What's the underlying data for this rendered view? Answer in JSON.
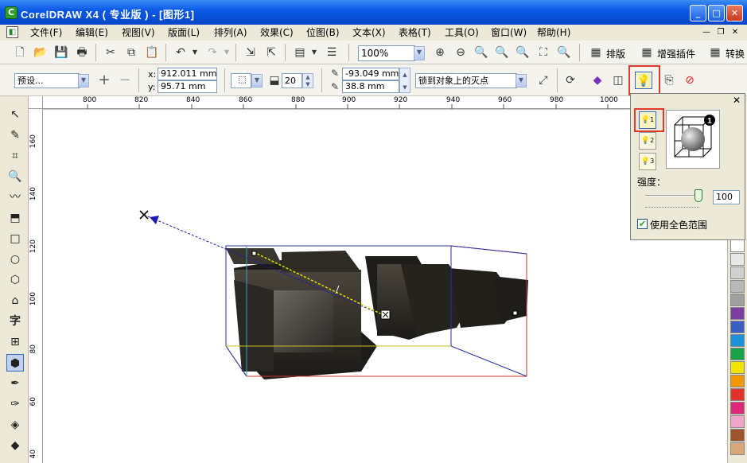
{
  "window": {
    "title": "CorelDRAW X4 ( 专业版 ) - [图形1]",
    "app_icon": "coreldraw-icon"
  },
  "menu": [
    "文件(F)",
    "编辑(E)",
    "视图(V)",
    "版面(L)",
    "排列(A)",
    "效果(C)",
    "位图(B)",
    "文本(X)",
    "表格(T)",
    "工具(O)",
    "窗口(W)",
    "帮助(H)"
  ],
  "toolbar1": {
    "zoom": "100%",
    "layout_label": "排版",
    "plugin_label": "增强插件",
    "convert_label": "转换"
  },
  "propbar": {
    "preset": "预设...",
    "x_label": "x:",
    "x_value": "912.011 mm",
    "y_label": "y:",
    "y_value": "95.71 mm",
    "depth_value": "20",
    "vp_x": "-93.049 mm",
    "vp_y": "38.8 mm",
    "vp_lock": "锁到对象上的灭点"
  },
  "ruler": {
    "h_ticks": [
      "800",
      "820",
      "840",
      "860",
      "880",
      "900",
      "920",
      "940",
      "960",
      "980",
      "1000"
    ],
    "v_ticks": [
      "160",
      "140",
      "120",
      "100",
      "80",
      "60",
      "40"
    ]
  },
  "lighting_panel": {
    "lights": [
      "1",
      "2",
      "3"
    ],
    "preview_badge": "1",
    "intensity_label": "强度：",
    "intensity_value": "100",
    "intensity": 100,
    "full_color_label": "使用全色范围",
    "full_color_checked": true
  },
  "colors": {
    "accent": "#e1392c",
    "titlebar": "#0a5ae6"
  },
  "palette": [
    "#ffffff",
    "#e8e8e8",
    "#d0d0d0",
    "#b8b8b8",
    "#a0a0a0",
    "#7b3fa0",
    "#3c5ec0",
    "#1e90d8",
    "#19a34a",
    "#f2e600",
    "#f39800",
    "#e4312b",
    "#e0287a",
    "#f0a6c8",
    "#a0522d",
    "#d8a878"
  ]
}
